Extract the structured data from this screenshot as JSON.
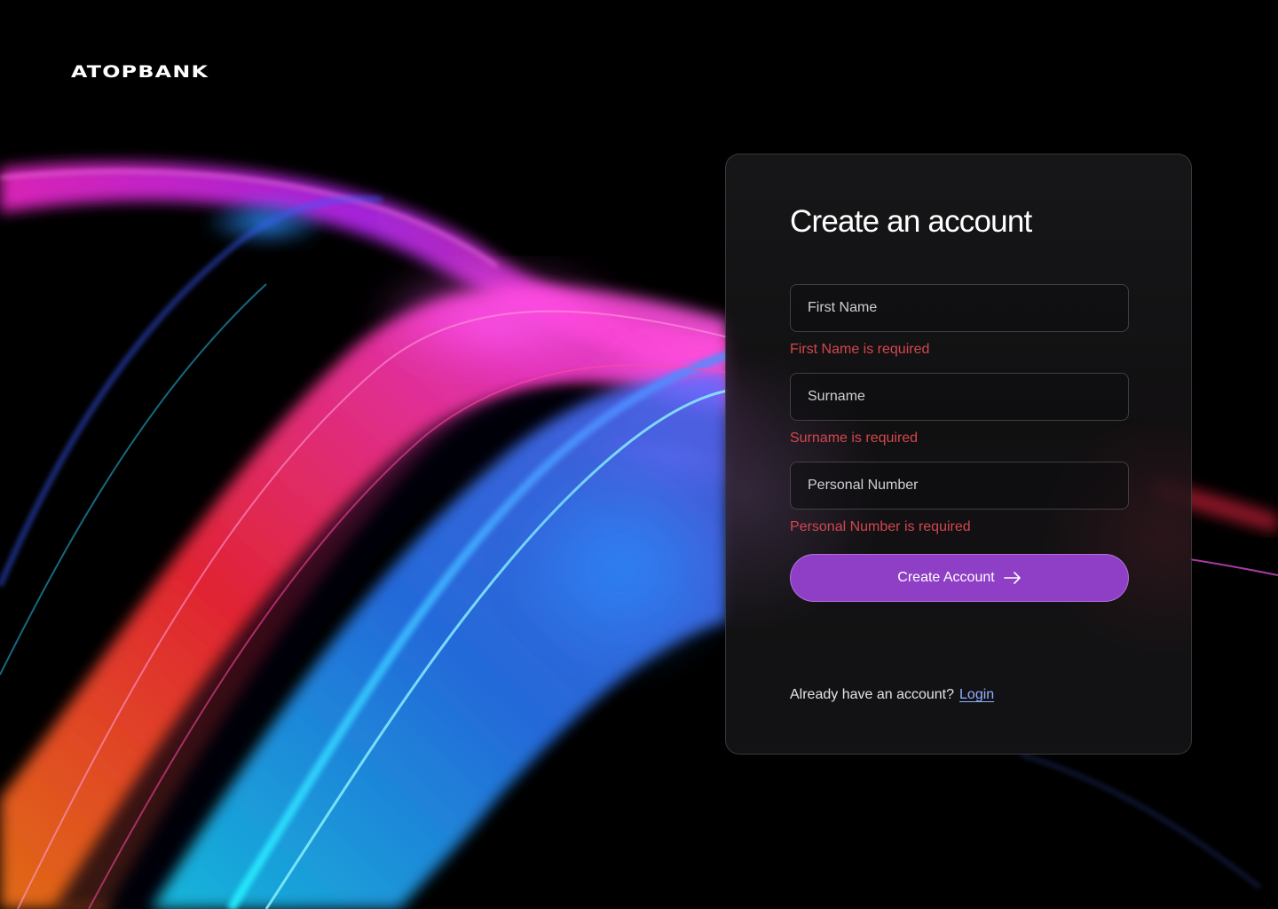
{
  "brand": {
    "logo_text": "ATOPBANK"
  },
  "form": {
    "title": "Create an account",
    "fields": [
      {
        "placeholder": "First Name",
        "value": "",
        "error": "First Name is required"
      },
      {
        "placeholder": "Surname",
        "value": "",
        "error": "Surname is required"
      },
      {
        "placeholder": "Personal Number",
        "value": "",
        "error": "Personal Number is required"
      }
    ],
    "submit_label": "Create Account",
    "submit_icon": "arrow-right-icon",
    "footer_text": "Already have an account?",
    "login_link": "Login"
  },
  "colors": {
    "background": "#000000",
    "accent": "#8e3fc6",
    "error": "#d2474f",
    "link": "#8fb0ff"
  }
}
